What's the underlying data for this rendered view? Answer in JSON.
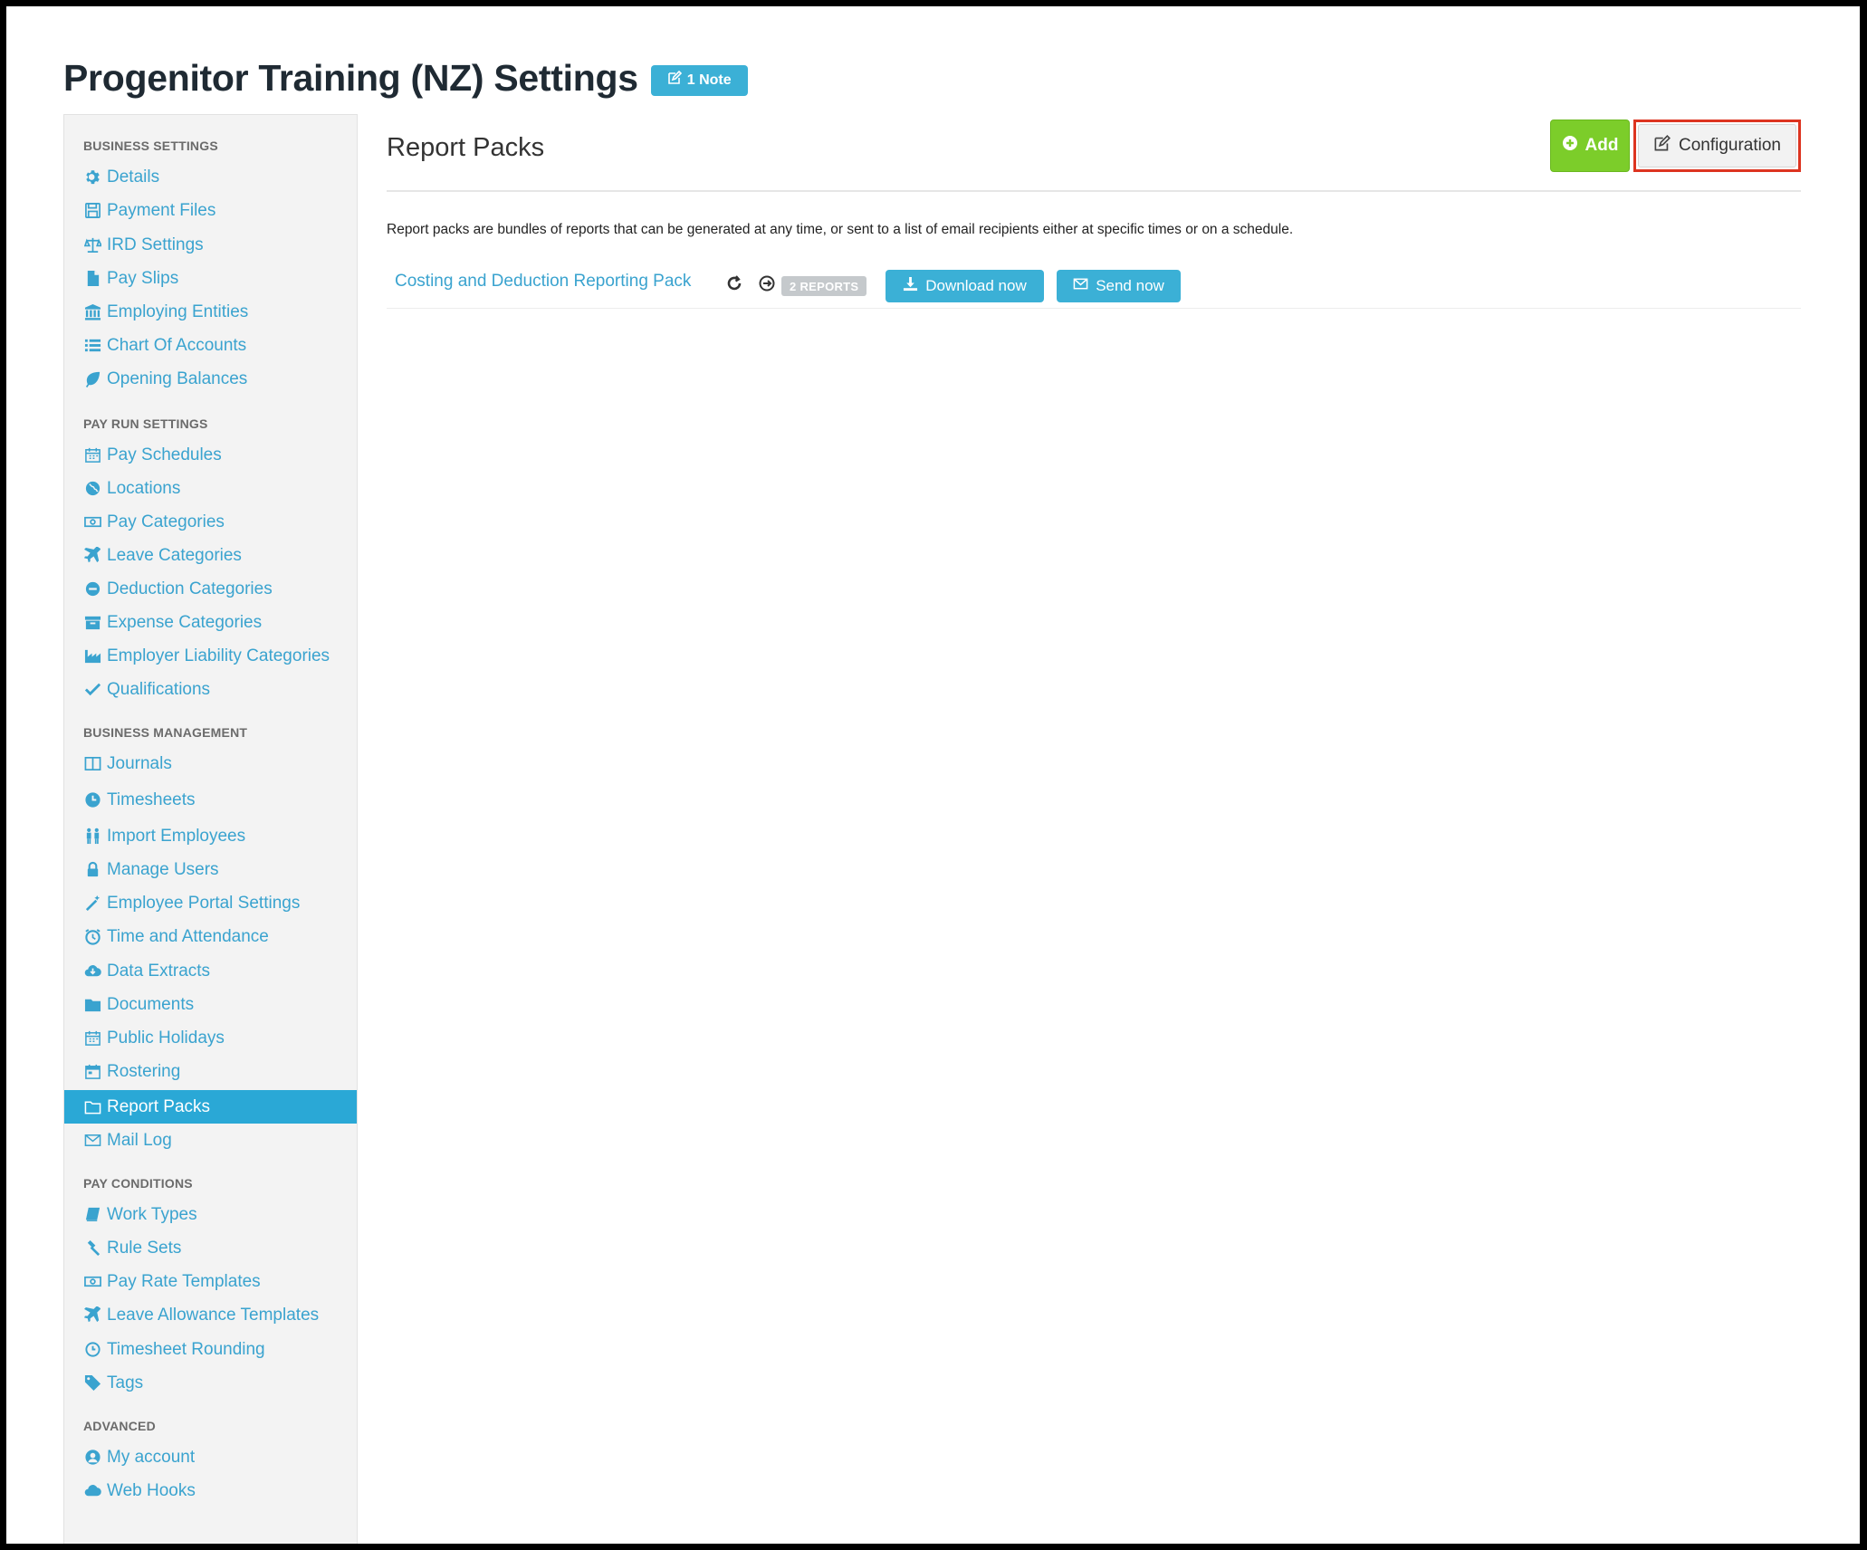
{
  "page": {
    "title": "Progenitor Training (NZ) Settings",
    "note_badge": "1 Note"
  },
  "sidebar": {
    "sections": [
      {
        "heading": "BUSINESS SETTINGS",
        "items": [
          {
            "label": "Details",
            "icon": "gear-icon"
          },
          {
            "label": "Payment Files",
            "icon": "floppy-icon"
          },
          {
            "label": "IRD Settings",
            "icon": "scale-icon"
          },
          {
            "label": "Pay Slips",
            "icon": "file-icon"
          },
          {
            "label": "Employing Entities",
            "icon": "institution-icon"
          },
          {
            "label": "Chart Of Accounts",
            "icon": "list-icon"
          },
          {
            "label": "Opening Balances",
            "icon": "leaf-icon"
          }
        ]
      },
      {
        "heading": "PAY RUN SETTINGS",
        "items": [
          {
            "label": "Pay Schedules",
            "icon": "calendar-icon"
          },
          {
            "label": "Locations",
            "icon": "globe-icon"
          },
          {
            "label": "Pay Categories",
            "icon": "money-icon"
          },
          {
            "label": "Leave Categories",
            "icon": "plane-icon"
          },
          {
            "label": "Deduction Categories",
            "icon": "minus-circle-icon"
          },
          {
            "label": "Expense Categories",
            "icon": "archive-icon"
          },
          {
            "label": "Employer Liability Categories",
            "icon": "industry-icon"
          },
          {
            "label": "Qualifications",
            "icon": "check-icon"
          }
        ]
      },
      {
        "heading": "BUSINESS MANAGEMENT",
        "items": [
          {
            "label": "Journals",
            "icon": "columns-icon"
          },
          {
            "label": "Timesheets",
            "icon": "clock-icon"
          },
          {
            "label": "Import Employees",
            "icon": "users-icon"
          },
          {
            "label": "Manage Users",
            "icon": "lock-icon"
          },
          {
            "label": "Employee Portal Settings",
            "icon": "wand-icon"
          },
          {
            "label": "Time and Attendance",
            "icon": "alarm-icon"
          },
          {
            "label": "Data Extracts",
            "icon": "cloud-download-icon"
          },
          {
            "label": "Documents",
            "icon": "folder-icon"
          },
          {
            "label": "Public Holidays",
            "icon": "calendar-icon"
          },
          {
            "label": "Rostering",
            "icon": "calendar-grid-icon"
          },
          {
            "label": "Report Packs",
            "icon": "folder-open-icon",
            "active": true
          },
          {
            "label": "Mail Log",
            "icon": "envelope-icon"
          }
        ]
      },
      {
        "heading": "PAY CONDITIONS",
        "items": [
          {
            "label": "Work Types",
            "icon": "book-icon"
          },
          {
            "label": "Rule Sets",
            "icon": "gavel-icon"
          },
          {
            "label": "Pay Rate Templates",
            "icon": "money-icon"
          },
          {
            "label": "Leave Allowance Templates",
            "icon": "plane-icon"
          },
          {
            "label": "Timesheet Rounding",
            "icon": "clock-outline-icon"
          },
          {
            "label": "Tags",
            "icon": "tag-icon"
          }
        ]
      },
      {
        "heading": "ADVANCED",
        "items": [
          {
            "label": "My account",
            "icon": "user-circle-icon"
          },
          {
            "label": "Web Hooks",
            "icon": "cloud-icon"
          }
        ]
      }
    ]
  },
  "main": {
    "heading": "Report Packs",
    "add_label": "Add",
    "config_label": "Configuration",
    "description": "Report packs are bundles of reports that can be generated at any time, or sent to a list of email recipients either at specific times or on a schedule.",
    "packs": [
      {
        "name": "Costing and Deduction Reporting Pack",
        "reports_badge": "2 REPORTS",
        "download_label": "Download now",
        "send_label": "Send now"
      }
    ]
  },
  "colors": {
    "accent": "#3bb0d6",
    "link": "#3aa3cf",
    "add_green": "#7ccd2a",
    "highlight_red": "#dd3420"
  }
}
